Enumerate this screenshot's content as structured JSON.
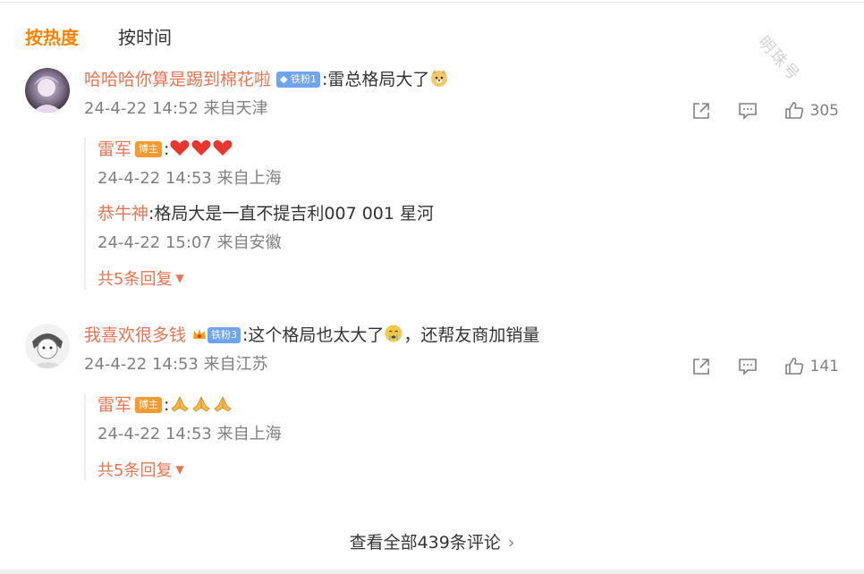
{
  "sort_tabs": {
    "hot": "按热度",
    "time": "按时间"
  },
  "watermark": "明珠号",
  "comments": [
    {
      "username": "哈哈哈你算是踢到棉花啦",
      "badge": "铁粉1",
      "text": ":雷总格局大了",
      "emoji": "doge-face",
      "time": "24-4-22 14:52",
      "location": "来自天津",
      "likes": "305",
      "replies": [
        {
          "username": "雷军",
          "badge": "博主",
          "text": ":",
          "emoji": [
            "heart",
            "heart",
            "heart"
          ],
          "time": "24-4-22 14:53",
          "location": "来自上海"
        },
        {
          "username": "恭牛神",
          "text": ":格局大是一直不提吉利007  001  星河",
          "time": "24-4-22 15:07",
          "location": "来自安徽"
        }
      ],
      "more_replies": "共5条回复"
    },
    {
      "username": "我喜欢很多钱",
      "badge": "铁粉3",
      "text": ":这个格局也太大了",
      "text_after": "，还帮友商加销量",
      "emoji": "crying-face",
      "time": "24-4-22 14:53",
      "location": "来自江苏",
      "likes": "141",
      "replies": [
        {
          "username": "雷军",
          "badge": "博主",
          "text": ":",
          "emoji": [
            "praying-hands",
            "praying-hands",
            "praying-hands"
          ],
          "time": "24-4-22 14:53",
          "location": "来自上海"
        }
      ],
      "more_replies": "共5条回复"
    }
  ],
  "view_all": "查看全部439条评论",
  "colors": {
    "accent": "#ff8200",
    "username": "#eb7350",
    "meta": "#808080",
    "fan_badge": "#6ea4f0",
    "blogger_badge": "#f59a2e"
  },
  "icons": [
    "share-icon",
    "comment-icon",
    "like-icon",
    "caret-down-icon",
    "chevron-right-icon"
  ]
}
